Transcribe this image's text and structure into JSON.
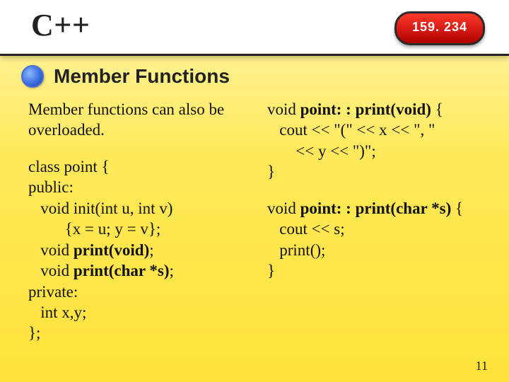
{
  "header": {
    "title": "C++",
    "course_code": "159. 234"
  },
  "subtitle": "Member Functions",
  "left": {
    "intro": "Member functions can also be overloaded.",
    "code": {
      "l1": "class point {",
      "l2": "public:",
      "l3": "   void init(int u, int v)",
      "l4": "         {x = u; y = v};",
      "l5a": "   void ",
      "l5b": "print(void)",
      "l5c": ";",
      "l6a": "   void ",
      "l6b": "print(char *s)",
      "l6c": ";",
      "l7": "private:",
      "l8": "   int x,y;",
      "l9": "};"
    }
  },
  "right": {
    "block1": {
      "l1a": "void ",
      "l1b": "point: : print(void)",
      "l1c": " {",
      "l2": "   cout << \"(\" << x << \", \"",
      "l3": "       << y << \")\";",
      "l4": "}"
    },
    "block2": {
      "l1a": "void ",
      "l1b": "point: : print(char *s)",
      "l1c": " {",
      "l2": "   cout << s;",
      "l3": "   print();",
      "l4": "}"
    }
  },
  "page_number": "11"
}
